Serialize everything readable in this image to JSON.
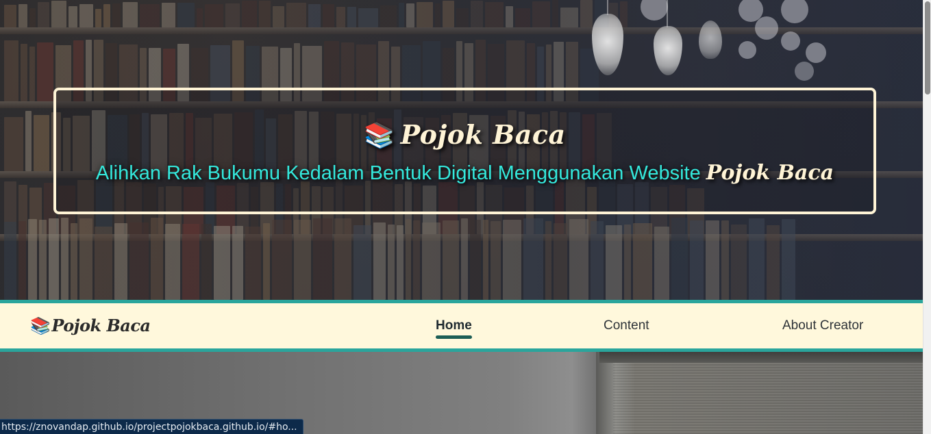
{
  "hero": {
    "banner_title": "Pojok Baca",
    "banner_icon": "📚",
    "subtitle_text": "Alihkan Rak Bukumu Kedalam Bentuk Digital Menggunakan Website",
    "subtitle_brand": "Pojok Baca"
  },
  "navbar": {
    "brand_icon": "📚",
    "brand_name": "Pojok Baca",
    "links": [
      {
        "label": "Home",
        "active": true
      },
      {
        "label": "Content",
        "active": false
      },
      {
        "label": "About Creator",
        "active": false
      }
    ]
  },
  "status_bar": {
    "url": "https://znovandap.github.io/projectpojokbaca.github.io/#ho..."
  },
  "colors": {
    "banner_border": "#fff4d6",
    "subtitle_teal": "#34e8dc",
    "navbar_bg": "#fff8dc",
    "navbar_border": "#2aa59c",
    "active_underline": "#1c5e56"
  }
}
